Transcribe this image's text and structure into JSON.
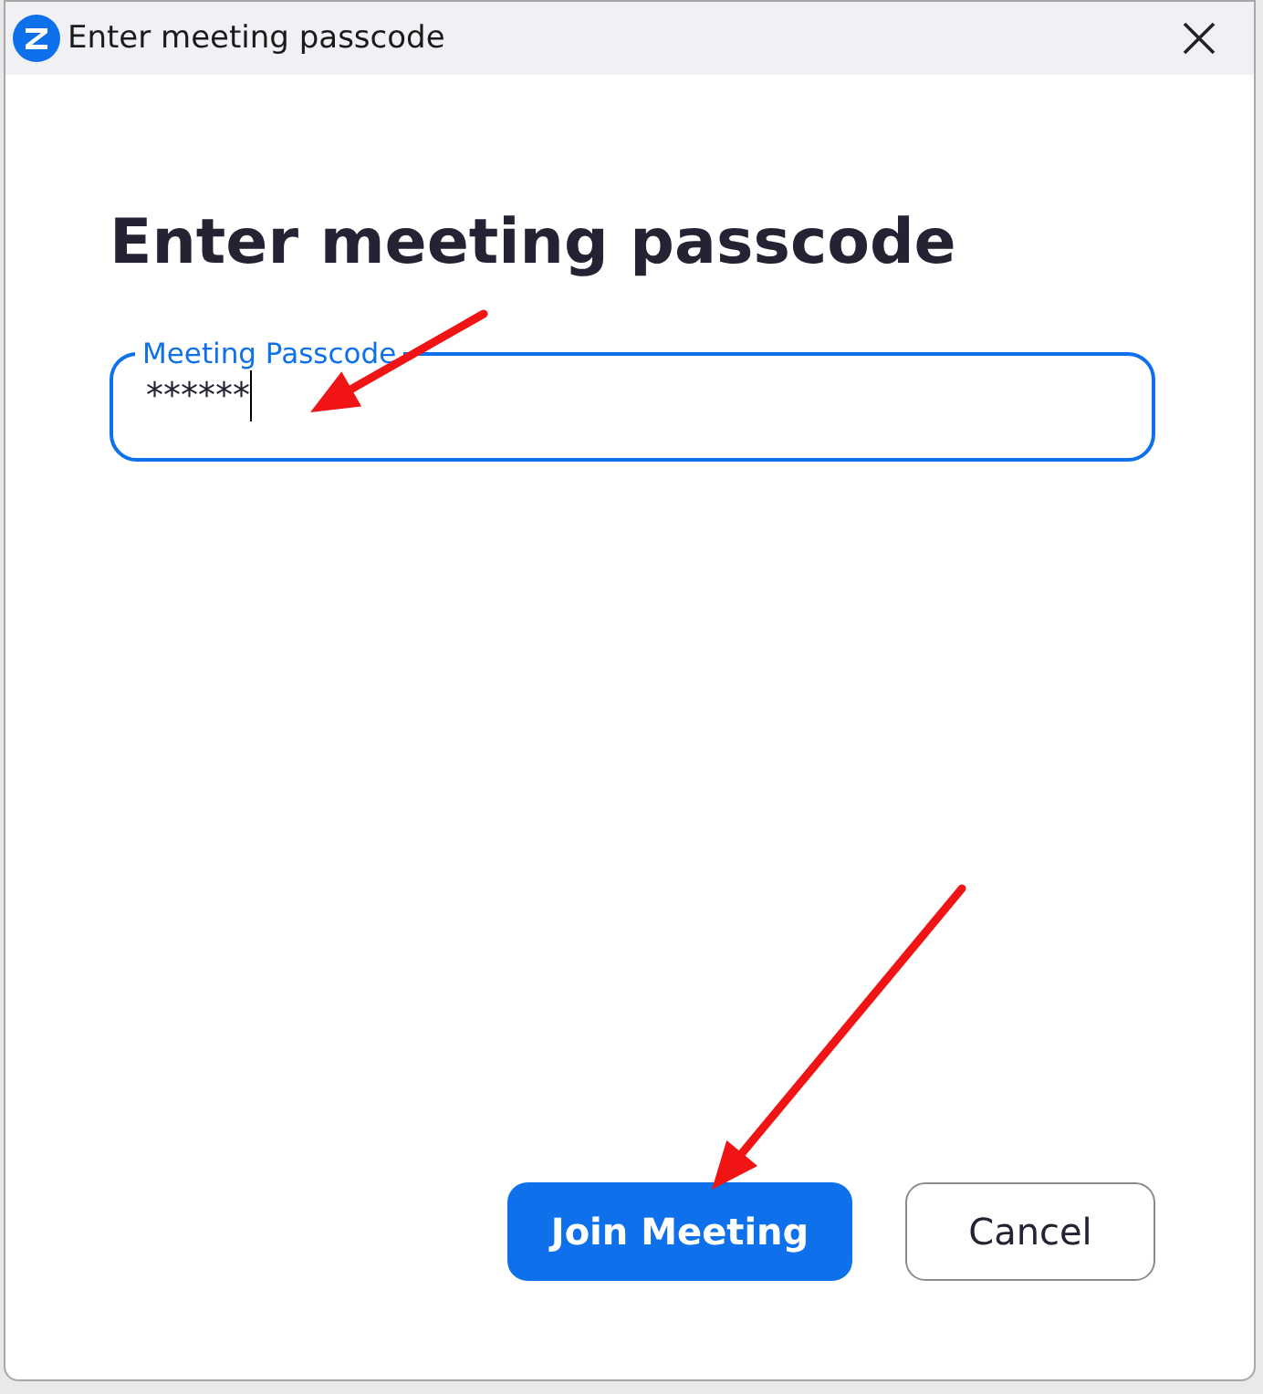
{
  "window": {
    "title": "Enter meeting passcode"
  },
  "heading": "Enter meeting passcode",
  "passcode_field": {
    "label": "Meeting Passcode",
    "value": "******",
    "focused": true
  },
  "buttons": [
    {
      "label": "Join Meeting",
      "kind": "primary"
    },
    {
      "label": "Cancel",
      "kind": "secondary"
    }
  ]
}
